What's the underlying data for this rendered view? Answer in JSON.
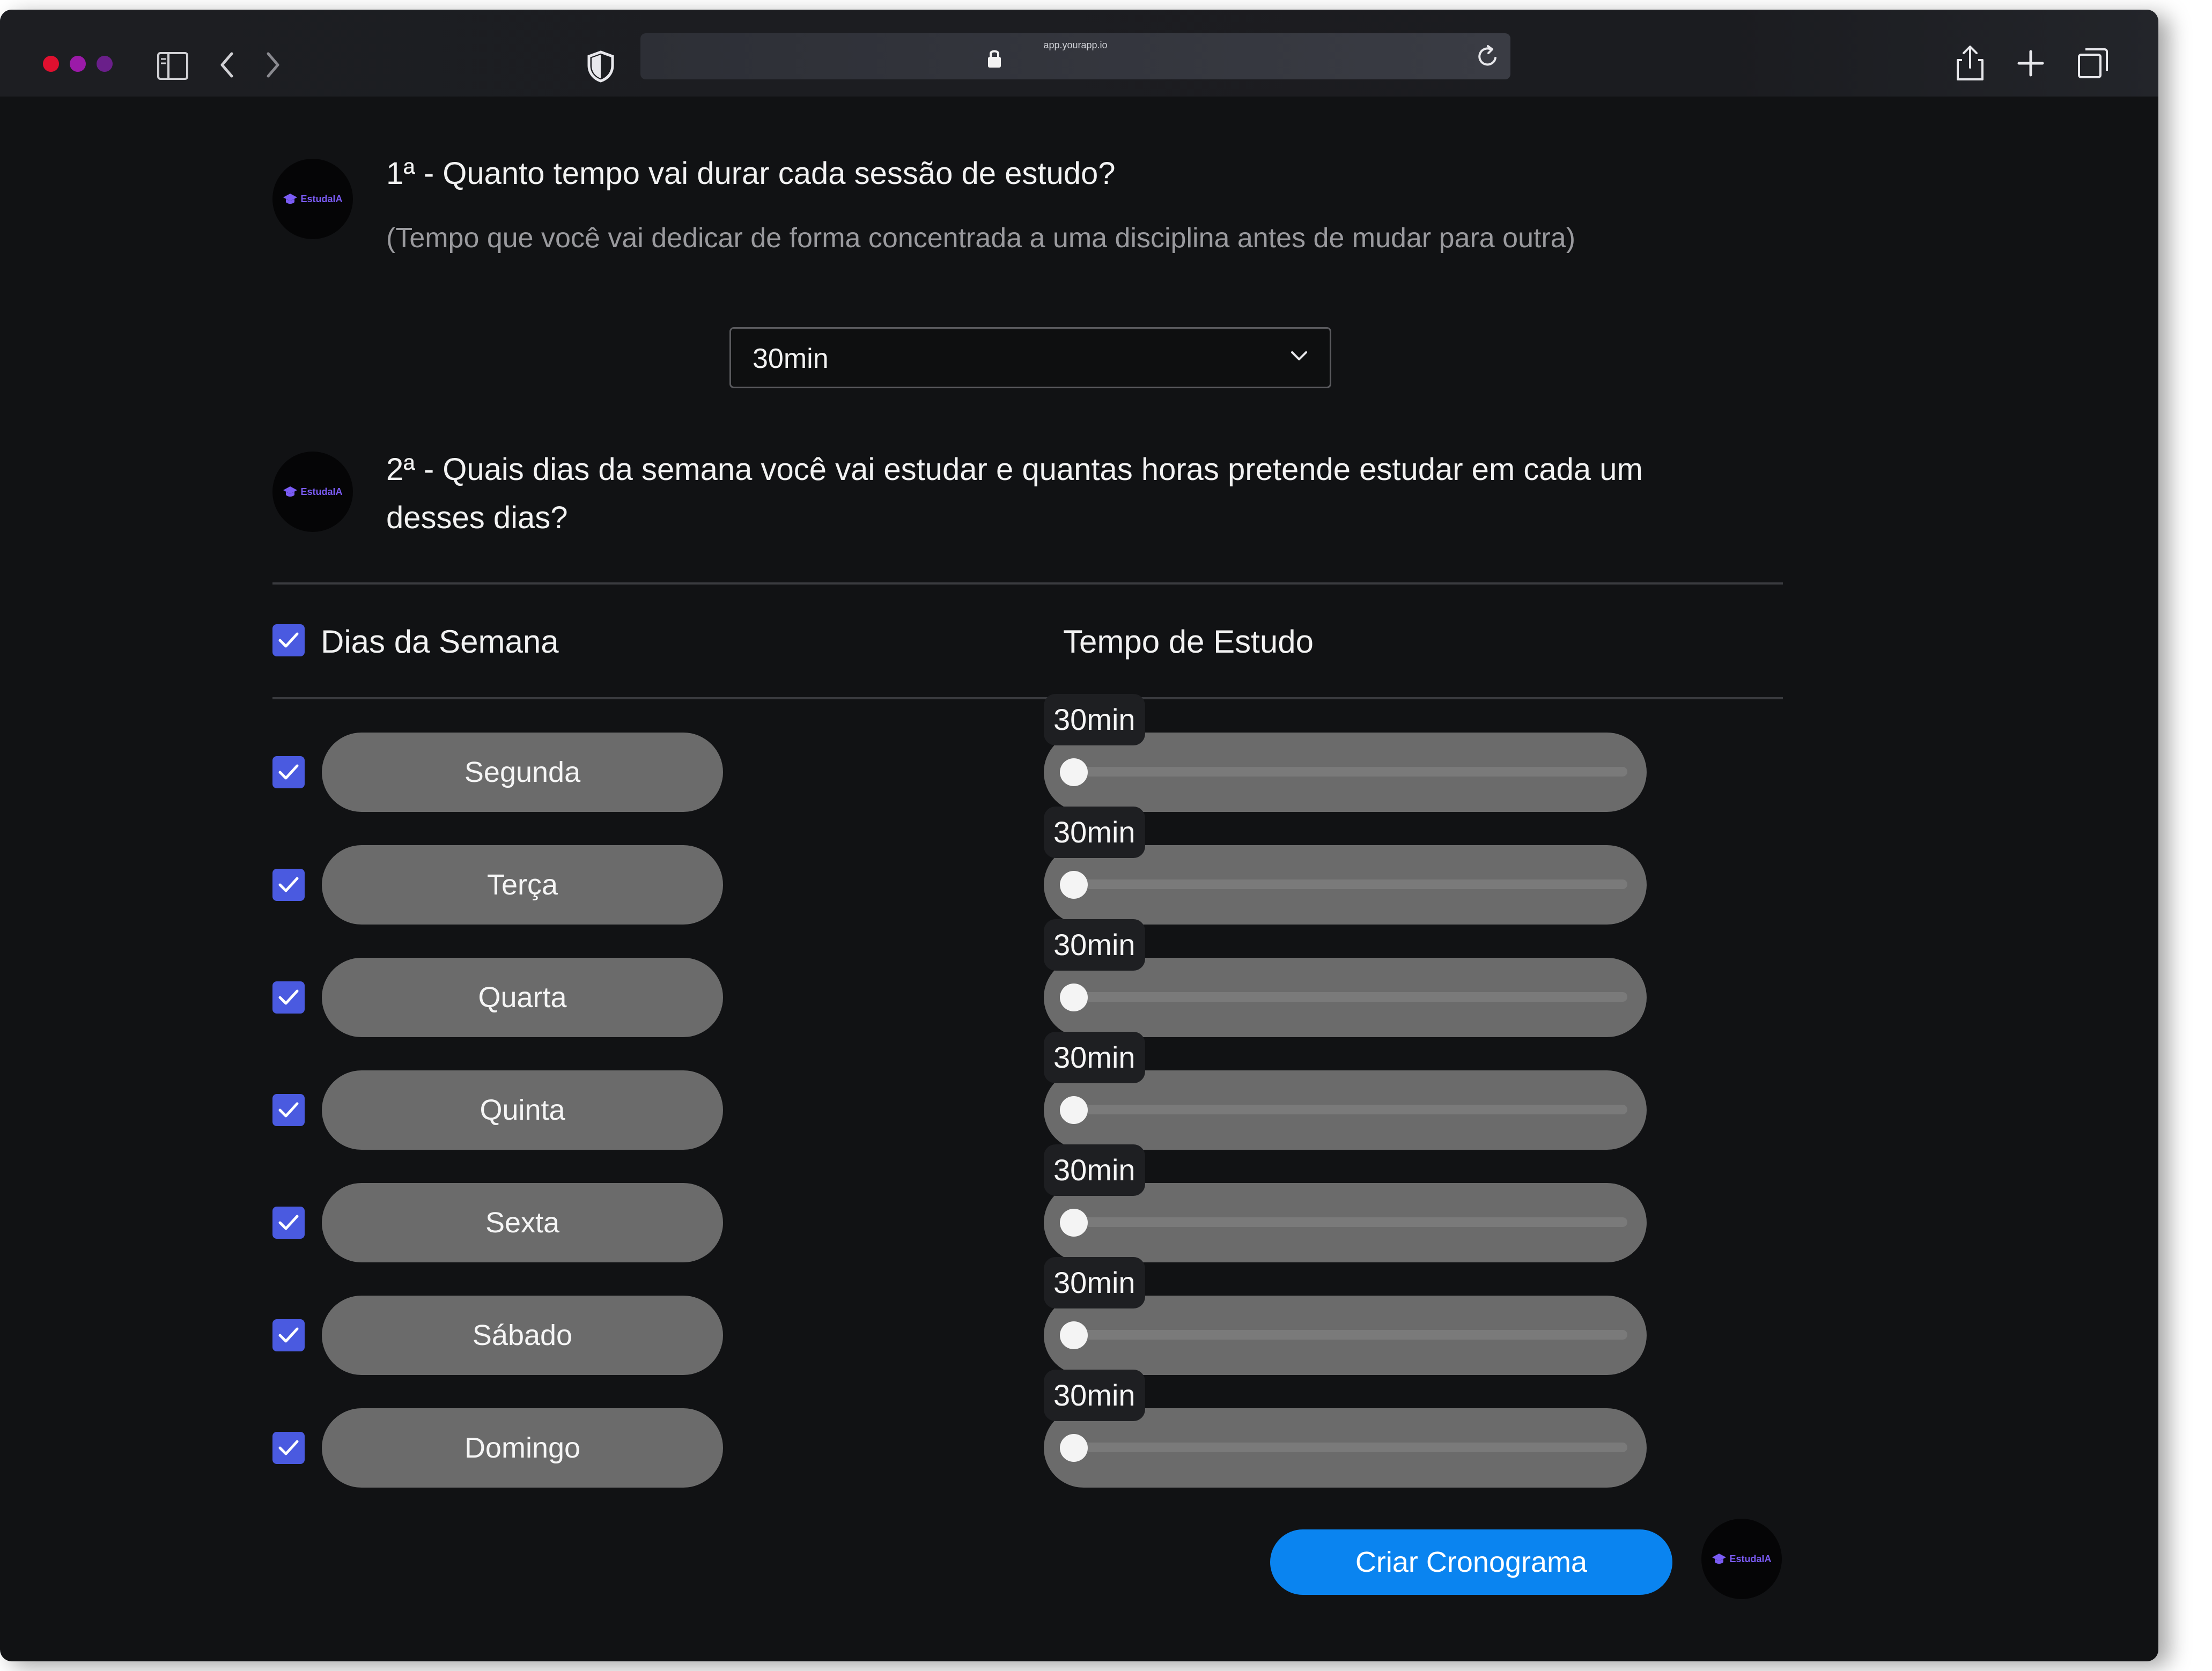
{
  "browser": {
    "url": "app.yourapp.io",
    "traffic_colors": [
      "#e0102f",
      "#9b1aa8",
      "#6a1f8a"
    ]
  },
  "brand": {
    "logo_text": "EstudaIA"
  },
  "question1": {
    "title": "1ª - Quanto tempo vai durar cada sessão de estudo?",
    "subtitle": "(Tempo que você vai dedicar de forma concentrada a uma disciplina antes de mudar para outra)",
    "selected": "30min"
  },
  "question2": {
    "title_line1": "2ª - Quais dias da semana você vai estudar e quantas horas pretende estudar em cada um",
    "title_line2": "desses dias?"
  },
  "table": {
    "days_header": "Dias da Semana",
    "time_header": "Tempo de Estudo",
    "all_checked": true,
    "days": [
      {
        "label": "Segunda",
        "checked": true,
        "time": "30min",
        "slider_fraction": 0
      },
      {
        "label": "Terça",
        "checked": true,
        "time": "30min",
        "slider_fraction": 0
      },
      {
        "label": "Quarta",
        "checked": true,
        "time": "30min",
        "slider_fraction": 0
      },
      {
        "label": "Quinta",
        "checked": true,
        "time": "30min",
        "slider_fraction": 0
      },
      {
        "label": "Sexta",
        "checked": true,
        "time": "30min",
        "slider_fraction": 0
      },
      {
        "label": "Sábado",
        "checked": true,
        "time": "30min",
        "slider_fraction": 0
      },
      {
        "label": "Domingo",
        "checked": true,
        "time": "30min",
        "slider_fraction": 0
      }
    ]
  },
  "actions": {
    "create_label": "Criar Cronograma"
  }
}
